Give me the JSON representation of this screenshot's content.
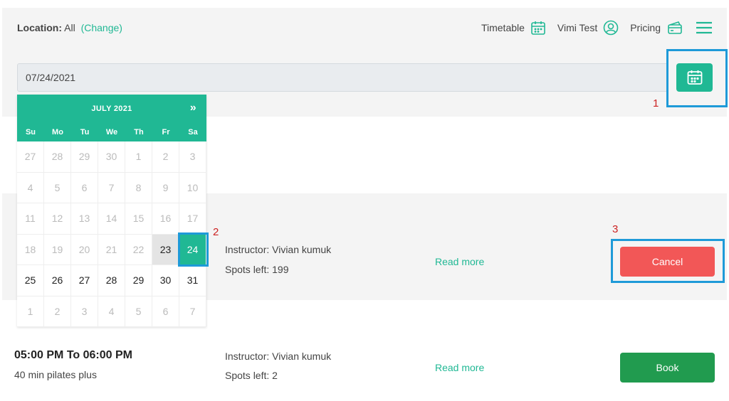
{
  "header": {
    "location_label": "Location:",
    "location_value": "All",
    "location_change": "(Change)",
    "nav": [
      {
        "label": "Timetable",
        "icon": "calendar-icon"
      },
      {
        "label": "Vimi Test",
        "icon": "user-circle-icon"
      },
      {
        "label": "Pricing",
        "icon": "credit-card-icon"
      }
    ],
    "menu_icon": "hamburger-menu-icon"
  },
  "date_input": {
    "value": "07/24/2021"
  },
  "calendar": {
    "month_label": "JULY 2021",
    "next_label": "»",
    "weekdays": [
      "Su",
      "Mo",
      "Tu",
      "We",
      "Th",
      "Fr",
      "Sa"
    ],
    "weeks": [
      [
        "27",
        "28",
        "29",
        "30",
        "1",
        "2",
        "3"
      ],
      [
        "4",
        "5",
        "6",
        "7",
        "8",
        "9",
        "10"
      ],
      [
        "11",
        "12",
        "13",
        "14",
        "15",
        "16",
        "17"
      ],
      [
        "18",
        "19",
        "20",
        "21",
        "22",
        "23",
        "24"
      ],
      [
        "25",
        "26",
        "27",
        "28",
        "29",
        "30",
        "31"
      ],
      [
        "1",
        "2",
        "3",
        "4",
        "5",
        "6",
        "7"
      ]
    ],
    "today": "23",
    "selected": "24"
  },
  "annotations": [
    "1",
    "2",
    "3"
  ],
  "sessions": [
    {
      "instructor": "Instructor: Vivian kumuk",
      "spots": "Spots left: 199",
      "read_more": "Read more",
      "action": "Cancel"
    },
    {
      "time": "05:00 PM To 06:00 PM",
      "class": "40 min pilates plus",
      "instructor": "Instructor: Vivian kumuk",
      "spots": "Spots left: 2",
      "read_more": "Read more",
      "action": "Book"
    }
  ],
  "colors": {
    "accent": "#20b894",
    "cancel": "#f25757",
    "book": "#219b4f",
    "highlight": "#1e9ad8",
    "annotation": "#cc2222"
  }
}
